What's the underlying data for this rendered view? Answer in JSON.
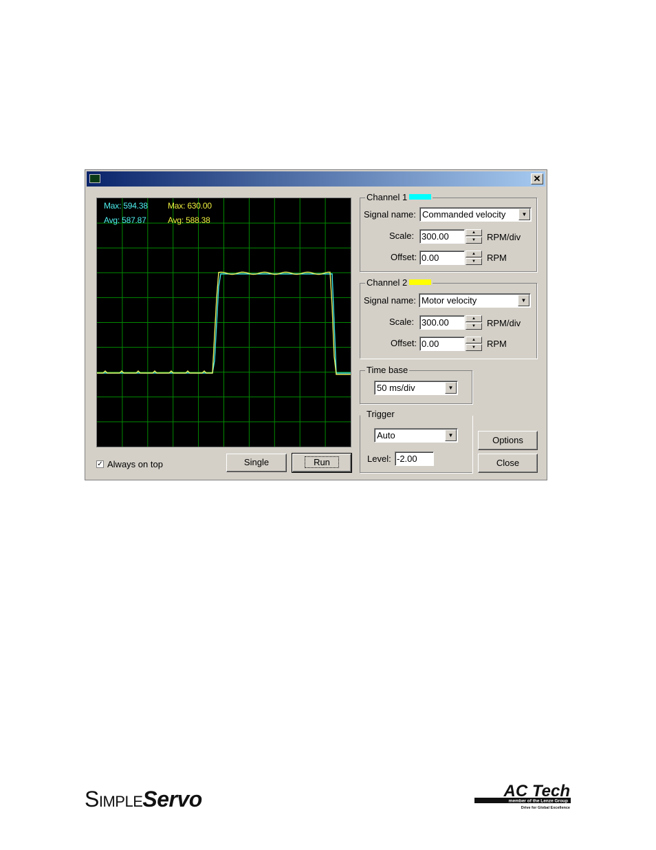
{
  "window": {
    "title": "",
    "close_glyph": "✕",
    "readouts": {
      "ch1_max": "Max: 594.38",
      "ch1_avg": "Avg: 587.87",
      "ch2_max": "Max: 630.00",
      "ch2_avg": "Avg: 588.38"
    },
    "always_on_top": {
      "label": "Always on top",
      "checked": true,
      "check_glyph": "✓"
    },
    "single_label": "Single",
    "run_label": "Run",
    "options_label": "Options",
    "close_label": "Close"
  },
  "channel1": {
    "legend": "Channel 1",
    "color": "#00ffff",
    "signal_label": "Signal name:",
    "signal": "Commanded velocity",
    "scale_label": "Scale:",
    "scale": "300.00",
    "scale_unit": "RPM/div",
    "offset_label": "Offset:",
    "offset": "0.00",
    "offset_unit": "RPM"
  },
  "channel2": {
    "legend": "Channel 2",
    "color": "#ffff00",
    "signal_label": "Signal name:",
    "signal": "Motor velocity",
    "scale_label": "Scale:",
    "scale": "300.00",
    "scale_unit": "RPM/div",
    "offset_label": "Offset:",
    "offset": "0.00",
    "offset_unit": "RPM"
  },
  "timebase": {
    "legend": "Time base",
    "value": "50 ms/div"
  },
  "trigger": {
    "legend": "Trigger",
    "mode": "Auto",
    "level_label": "Level:",
    "level": "-2.00"
  },
  "footer": {
    "brand_left_small": "Simple",
    "brand_left_bold": "Servo",
    "brand_right": "AC Tech",
    "brand_right_bar": "member of the Lenze Group",
    "brand_right_tagline": "Drive for Global Excellence"
  },
  "colors": {
    "grid": "#008a00",
    "trace_ch1": "#40e8e8",
    "trace_ch2": "#e8f060"
  }
}
